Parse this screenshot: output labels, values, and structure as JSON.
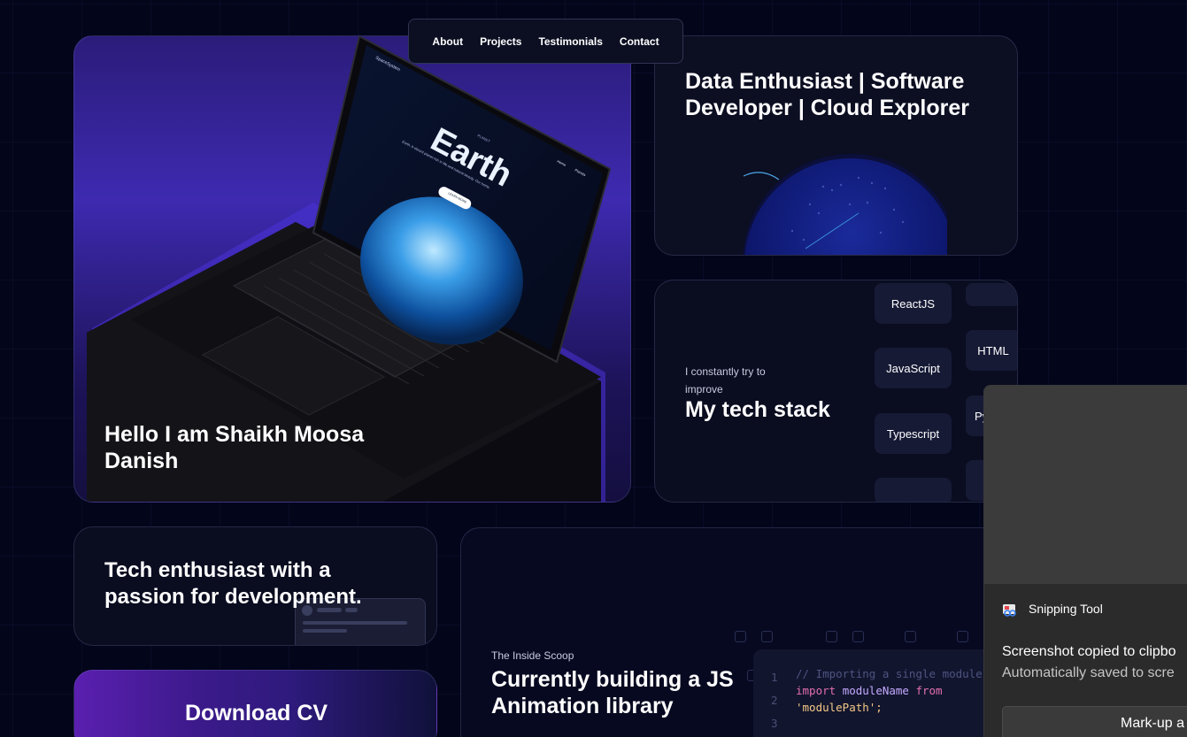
{
  "nav": {
    "items": [
      "About",
      "Projects",
      "Testimonials",
      "Contact"
    ]
  },
  "hero": {
    "title": "Hello I am Shaikh Moosa Danish"
  },
  "role": {
    "title": "Data Enthusiast | Software Developer | Cloud Explorer"
  },
  "stack": {
    "subtitle": "I constantly try to improve",
    "title": "My tech stack",
    "chips": [
      "ReactJS",
      "JavaScript",
      "Typescript",
      "HTML",
      "Py"
    ]
  },
  "enthusiast": {
    "title": "Tech enthusiast with a passion for development."
  },
  "cv": {
    "label": "Download CV"
  },
  "scoop": {
    "subtitle": "The Inside Scoop",
    "title": "Currently building a JS Animation library",
    "code": {
      "line_numbers": [
        "1",
        "2",
        "3"
      ],
      "comment": "// Importing a single module",
      "keyword_import": "import",
      "module_name": "moduleName",
      "keyword_from": "from",
      "path": "'modulePath';"
    }
  },
  "laptop_screen": {
    "brand": "SpaceSystem",
    "planet_label": "PLANET",
    "planet_name": "Earth",
    "tagline": "Earth: A vibrant planet rich in life and natural beauty. Our home.",
    "button": "LEARN MORE",
    "nav_home": "Home",
    "nav_planets": "Planets"
  },
  "toast": {
    "app_name": "Snipping Tool",
    "message": "Screenshot copied to clipbo",
    "submessage": "Automatically saved to scre",
    "button": "Mark-up a"
  },
  "colors": {
    "background": "#03051a",
    "accent_purple": "#3d2ab0",
    "card": "#0b0d24",
    "code_keyword": "#e26fb0",
    "code_comment": "#4d5480",
    "code_module": "#c4a9ff"
  }
}
